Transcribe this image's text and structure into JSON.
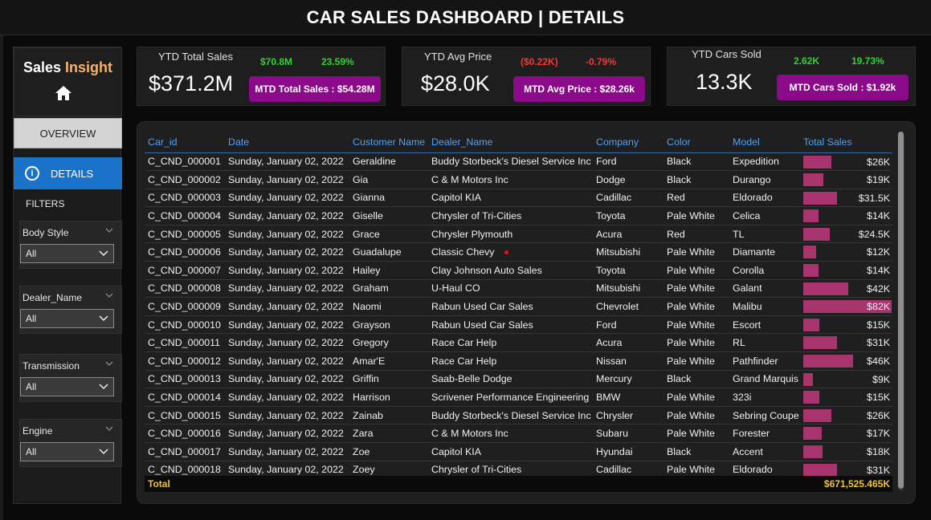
{
  "header": {
    "title": "CAR SALES DASHBOARD | DETAILS"
  },
  "sidebar": {
    "brand_white": "Sales ",
    "brand_orange": "Insight",
    "home_icon": "home-icon",
    "overview_label": "OVERVIEW",
    "details_label": "DETAILS",
    "filters_label": "FILTERS",
    "filters": [
      {
        "label": "Body Style",
        "value": "All"
      },
      {
        "label": "Dealer_Name",
        "value": "All"
      },
      {
        "label": "Transmission",
        "value": "All"
      },
      {
        "label": "Engine",
        "value": "All"
      }
    ]
  },
  "kpis": {
    "sales": {
      "label": "YTD Total Sales",
      "value": "$371.2M",
      "delta_abs": "$70.8M",
      "delta_pct": "23.59%",
      "mtd": "MTD Total Sales : $54.28M"
    },
    "price": {
      "label": "YTD Avg Price",
      "value": "$28.0K",
      "delta_abs": "($0.22K)",
      "delta_pct": "-0.79%",
      "mtd": "MTD Avg Price : $28.26k"
    },
    "cars": {
      "label": "YTD Cars Sold",
      "value": "13.3K",
      "delta_abs": "2.62K",
      "delta_pct": "19.73%",
      "mtd": "MTD Cars Sold : $1.92k"
    }
  },
  "colors": {
    "positive": "#2fd42f",
    "negative": "#ff3333",
    "mtd_button": "#8a0a8a",
    "bar": "#a8346e",
    "header_text": "#4aa3ff",
    "total_text": "#f2c230"
  },
  "table": {
    "columns": [
      "Car_id",
      "Date",
      "Customer Name",
      "Dealer_Name",
      "Company",
      "Color",
      "Model",
      "Total Sales"
    ],
    "max_sales": 82,
    "rows": [
      [
        "C_CND_000001",
        "Sunday, January 02, 2022",
        "Geraldine",
        "Buddy Storbeck's Diesel Service Inc",
        "Ford",
        "Black",
        "Expedition",
        "$26K",
        26
      ],
      [
        "C_CND_000002",
        "Sunday, January 02, 2022",
        "Gia",
        "C & M Motors Inc",
        "Dodge",
        "Black",
        "Durango",
        "$19K",
        19
      ],
      [
        "C_CND_000003",
        "Sunday, January 02, 2022",
        "Gianna",
        "Capitol KIA",
        "Cadillac",
        "Red",
        "Eldorado",
        "$31.5K",
        31.5
      ],
      [
        "C_CND_000004",
        "Sunday, January 02, 2022",
        "Giselle",
        "Chrysler of Tri-Cities",
        "Toyota",
        "Pale White",
        "Celica",
        "$14K",
        14
      ],
      [
        "C_CND_000005",
        "Sunday, January 02, 2022",
        "Grace",
        "Chrysler Plymouth",
        "Acura",
        "Red",
        "TL",
        "$24.5K",
        24.5
      ],
      [
        "C_CND_000006",
        "Sunday, January 02, 2022",
        "Guadalupe",
        "Classic Chevy",
        "Mitsubishi",
        "Pale White",
        "Diamante",
        "$12K",
        12
      ],
      [
        "C_CND_000007",
        "Sunday, January 02, 2022",
        "Hailey",
        "Clay Johnson Auto Sales",
        "Toyota",
        "Pale White",
        "Corolla",
        "$14K",
        14
      ],
      [
        "C_CND_000008",
        "Sunday, January 02, 2022",
        "Graham",
        "U-Haul CO",
        "Mitsubishi",
        "Pale White",
        "Galant",
        "$42K",
        42
      ],
      [
        "C_CND_000009",
        "Sunday, January 02, 2022",
        "Naomi",
        "Rabun Used Car Sales",
        "Chevrolet",
        "Pale White",
        "Malibu",
        "$82K",
        82
      ],
      [
        "C_CND_000010",
        "Sunday, January 02, 2022",
        "Grayson",
        "Rabun Used Car Sales",
        "Ford",
        "Pale White",
        "Escort",
        "$15K",
        15
      ],
      [
        "C_CND_000011",
        "Sunday, January 02, 2022",
        "Gregory",
        "Race Car Help",
        "Acura",
        "Pale White",
        "RL",
        "$31K",
        31
      ],
      [
        "C_CND_000012",
        "Sunday, January 02, 2022",
        "Amar'E",
        "Race Car Help",
        "Nissan",
        "Pale White",
        "Pathfinder",
        "$46K",
        46
      ],
      [
        "C_CND_000013",
        "Sunday, January 02, 2022",
        "Griffin",
        "Saab-Belle Dodge",
        "Mercury",
        "Black",
        "Grand Marquis",
        "$9K",
        9
      ],
      [
        "C_CND_000014",
        "Sunday, January 02, 2022",
        "Harrison",
        "Scrivener Performance Engineering",
        "BMW",
        "Pale White",
        "323i",
        "$15K",
        15
      ],
      [
        "C_CND_000015",
        "Sunday, January 02, 2022",
        "Zainab",
        "Buddy Storbeck's Diesel Service Inc",
        "Chrysler",
        "Pale White",
        "Sebring Coupe",
        "$26K",
        26
      ],
      [
        "C_CND_000016",
        "Sunday, January 02, 2022",
        "Zara",
        "C & M Motors Inc",
        "Subaru",
        "Pale White",
        "Forester",
        "$17K",
        17
      ],
      [
        "C_CND_000017",
        "Sunday, January 02, 2022",
        "Zoe",
        "Capitol KIA",
        "Hyundai",
        "Black",
        "Accent",
        "$18K",
        18
      ],
      [
        "C_CND_000018",
        "Sunday, January 02, 2022",
        "Zoey",
        "Chrysler of Tri-Cities",
        "Cadillac",
        "Pale White",
        "Eldorado",
        "$31K",
        31
      ]
    ],
    "total_label": "Total",
    "total_value": "$671,525.465K"
  }
}
